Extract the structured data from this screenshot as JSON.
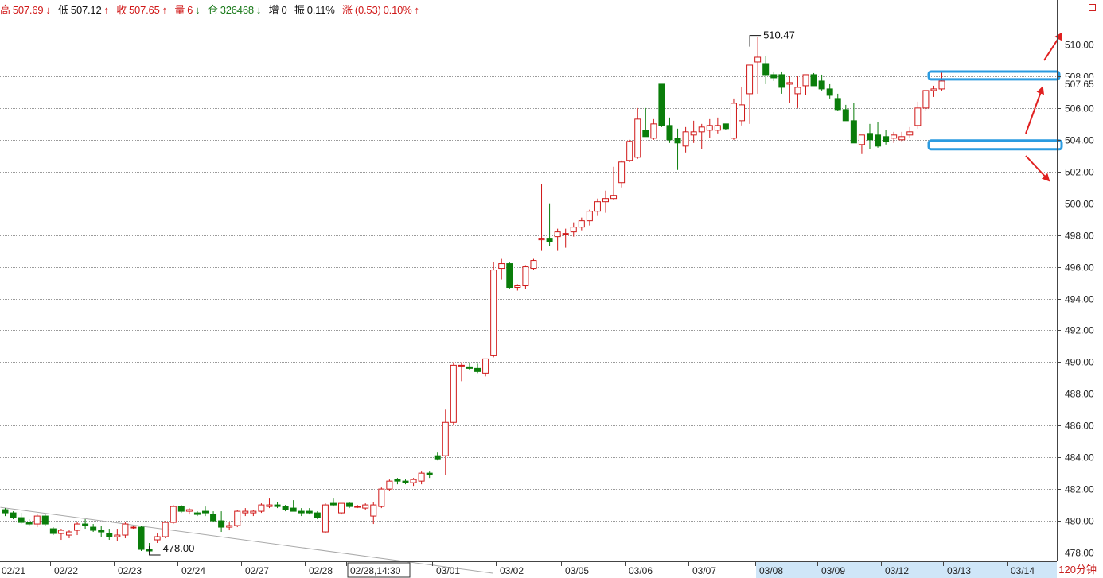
{
  "header": {
    "high_label": "高",
    "high_value": "507.69",
    "high_arrow": "↓",
    "low_label": "低",
    "low_value": "507.12",
    "low_arrow": "↑",
    "close_label": "收",
    "close_value": "507.65",
    "close_arrow": "↑",
    "volume_label": "量",
    "volume_value": "6",
    "volume_arrow": "↓",
    "oi_label": "仓",
    "oi_value": "326468",
    "oi_arrow": "↓",
    "increase_label": "增",
    "increase_value": "0",
    "amplitude_label": "振",
    "amplitude_value": "0.11%",
    "change_label": "涨",
    "change_value": "(0.53)",
    "change_pct": "0.10%",
    "change_arrow": "↑"
  },
  "timeframe": "120分钟",
  "colors": {
    "up": "#d01818",
    "down": "#0a7d0a",
    "highlight": "#2b9be0",
    "arrow": "#e02020",
    "grid": "#9a9a9a"
  },
  "chart_data": {
    "type": "candlestick",
    "ylim": [
      477.6,
      511.6
    ],
    "y_ticks": [
      "478.00",
      "480.00",
      "482.00",
      "484.00",
      "486.00",
      "488.00",
      "490.00",
      "492.00",
      "494.00",
      "496.00",
      "498.00",
      "500.00",
      "502.00",
      "504.00",
      "506.00",
      "508.00",
      "510.00"
    ],
    "x_labels": [
      "02/21",
      "02/22",
      "02/23",
      "02/24",
      "02/27",
      "02/28",
      "02/28,14:30",
      "03/01",
      "03/02",
      "03/05",
      "03/06",
      "03/07",
      "03/08",
      "03/09",
      "03/12",
      "03/13",
      "03/14"
    ],
    "current_price": "507.65",
    "annotations": {
      "max": "510.47",
      "min": "478.00"
    },
    "candles": [
      [
        480.7,
        480.8,
        480.3,
        480.5
      ],
      [
        480.5,
        480.6,
        480.1,
        480.2
      ],
      [
        480.2,
        480.5,
        479.8,
        479.9
      ],
      [
        479.9,
        480.1,
        479.7,
        479.8
      ],
      [
        479.8,
        480.4,
        479.6,
        480.3
      ],
      [
        480.3,
        480.4,
        479.7,
        479.8
      ],
      [
        479.5,
        479.6,
        479.1,
        479.2
      ],
      [
        479.2,
        479.5,
        478.8,
        479.4
      ],
      [
        479.1,
        479.4,
        478.9,
        479.3
      ],
      [
        479.4,
        479.9,
        479.1,
        479.8
      ],
      [
        479.8,
        480.1,
        479.5,
        479.7
      ],
      [
        479.6,
        479.8,
        479.3,
        479.4
      ],
      [
        479.4,
        479.7,
        479.0,
        479.3
      ],
      [
        479.2,
        479.5,
        478.8,
        479.0
      ],
      [
        479.0,
        479.5,
        478.7,
        479.1
      ],
      [
        479.1,
        479.9,
        478.9,
        479.8
      ],
      [
        479.6,
        479.7,
        479.5,
        479.6
      ],
      [
        479.6,
        479.7,
        478.1,
        478.2
      ],
      [
        478.2,
        478.6,
        478.0,
        478.1
      ],
      [
        478.8,
        479.2,
        478.6,
        479.0
      ],
      [
        479.0,
        480.0,
        478.9,
        479.9
      ],
      [
        479.9,
        481.0,
        479.8,
        480.9
      ],
      [
        480.9,
        481.0,
        480.5,
        480.6
      ],
      [
        480.6,
        480.8,
        480.4,
        480.7
      ],
      [
        480.5,
        480.6,
        480.3,
        480.4
      ],
      [
        480.6,
        480.9,
        480.3,
        480.5
      ],
      [
        480.4,
        480.6,
        479.9,
        480.0
      ],
      [
        480.0,
        480.6,
        479.3,
        479.6
      ],
      [
        479.6,
        479.9,
        479.4,
        479.7
      ],
      [
        479.7,
        480.7,
        479.6,
        480.6
      ],
      [
        480.5,
        480.8,
        480.3,
        480.6
      ],
      [
        480.5,
        480.7,
        480.3,
        480.6
      ],
      [
        480.6,
        481.1,
        480.5,
        481.0
      ],
      [
        480.9,
        481.4,
        480.8,
        481.0
      ],
      [
        481.0,
        481.2,
        480.8,
        480.9
      ],
      [
        480.9,
        481.0,
        480.6,
        480.7
      ],
      [
        480.8,
        481.3,
        480.6,
        480.6
      ],
      [
        480.6,
        480.8,
        480.3,
        480.5
      ],
      [
        480.6,
        480.8,
        480.4,
        480.5
      ],
      [
        480.5,
        480.6,
        480.1,
        480.2
      ],
      [
        479.3,
        481.1,
        479.2,
        481.0
      ],
      [
        481.1,
        481.4,
        480.9,
        481.0
      ],
      [
        480.5,
        481.1,
        480.4,
        481.1
      ],
      [
        481.1,
        481.2,
        480.8,
        480.9
      ],
      [
        480.9,
        481.0,
        480.8,
        480.9
      ],
      [
        480.8,
        481.1,
        480.7,
        481.0
      ],
      [
        480.3,
        481.2,
        479.8,
        481.0
      ],
      [
        480.9,
        482.1,
        480.8,
        482.0
      ],
      [
        482.0,
        482.6,
        481.9,
        482.5
      ],
      [
        482.6,
        482.7,
        482.3,
        482.5
      ],
      [
        482.5,
        482.6,
        482.3,
        482.4
      ],
      [
        482.4,
        482.7,
        482.2,
        482.6
      ],
      [
        482.5,
        483.1,
        482.3,
        483.0
      ],
      [
        483.0,
        483.1,
        482.7,
        482.9
      ],
      [
        484.1,
        484.3,
        483.8,
        483.9
      ],
      [
        484.1,
        487.0,
        482.9,
        486.2
      ],
      [
        486.2,
        490.0,
        486.0,
        489.8
      ],
      [
        489.8,
        490.0,
        488.8,
        489.8
      ],
      [
        489.7,
        490.0,
        489.5,
        489.6
      ],
      [
        489.6,
        489.9,
        489.3,
        489.4
      ],
      [
        489.3,
        490.2,
        489.1,
        490.2
      ],
      [
        490.4,
        496.3,
        490.3,
        495.8
      ],
      [
        495.9,
        496.5,
        495.2,
        496.2
      ],
      [
        496.2,
        496.3,
        494.6,
        494.7
      ],
      [
        494.7,
        494.9,
        494.5,
        494.8
      ],
      [
        494.8,
        496.1,
        494.6,
        496.0
      ],
      [
        495.9,
        496.5,
        495.8,
        496.4
      ],
      [
        497.7,
        501.2,
        497.0,
        497.8
      ],
      [
        497.8,
        500.0,
        497.3,
        497.6
      ],
      [
        497.9,
        498.4,
        497.0,
        498.2
      ],
      [
        498.1,
        498.4,
        497.2,
        498.1
      ],
      [
        498.2,
        498.8,
        497.9,
        498.5
      ],
      [
        498.5,
        499.1,
        498.3,
        498.9
      ],
      [
        498.9,
        499.6,
        498.6,
        499.5
      ],
      [
        499.5,
        500.3,
        499.2,
        500.1
      ],
      [
        500.1,
        500.8,
        499.4,
        500.3
      ],
      [
        500.3,
        502.3,
        500.2,
        500.5
      ],
      [
        501.3,
        502.7,
        501.0,
        502.6
      ],
      [
        502.7,
        504.0,
        502.6,
        503.9
      ],
      [
        502.9,
        506.0,
        502.8,
        505.3
      ],
      [
        504.6,
        506.0,
        504.3,
        504.2
      ],
      [
        504.1,
        505.3,
        504.0,
        505.0
      ],
      [
        507.5,
        507.5,
        504.8,
        504.9
      ],
      [
        504.9,
        505.4,
        503.8,
        504.0
      ],
      [
        504.1,
        504.7,
        502.1,
        503.8
      ],
      [
        503.6,
        504.8,
        503.2,
        504.5
      ],
      [
        504.3,
        505.2,
        503.8,
        504.5
      ],
      [
        504.5,
        505.0,
        503.4,
        504.8
      ],
      [
        504.6,
        505.3,
        504.1,
        504.9
      ],
      [
        504.6,
        505.4,
        504.4,
        504.9
      ],
      [
        505.0,
        505.0,
        504.6,
        504.7
      ],
      [
        504.1,
        506.6,
        504.0,
        506.3
      ],
      [
        505.2,
        507.3,
        504.9,
        506.2
      ],
      [
        506.9,
        508.2,
        505.0,
        508.7
      ],
      [
        508.9,
        510.5,
        506.9,
        509.2
      ],
      [
        508.8,
        509.3,
        507.5,
        508.1
      ],
      [
        508.1,
        508.3,
        507.7,
        507.9
      ],
      [
        508.1,
        508.3,
        506.9,
        507.3
      ],
      [
        507.5,
        508.0,
        506.3,
        507.6
      ],
      [
        506.9,
        508.0,
        506.0,
        507.3
      ],
      [
        507.4,
        508.0,
        506.8,
        508.1
      ],
      [
        508.1,
        508.2,
        507.4,
        507.4
      ],
      [
        507.7,
        508.1,
        507.1,
        507.2
      ],
      [
        507.2,
        507.5,
        506.6,
        506.8
      ],
      [
        506.6,
        506.9,
        505.8,
        505.9
      ],
      [
        505.9,
        506.2,
        505.4,
        505.2
      ],
      [
        505.2,
        506.3,
        504.0,
        503.8
      ],
      [
        503.7,
        504.1,
        503.1,
        504.3
      ],
      [
        504.4,
        505.0,
        503.4,
        504.0
      ],
      [
        504.3,
        505.1,
        503.5,
        503.6
      ],
      [
        504.2,
        504.6,
        503.7,
        503.9
      ],
      [
        504.1,
        504.5,
        503.8,
        504.3
      ],
      [
        504.0,
        504.5,
        503.9,
        504.2
      ],
      [
        504.3,
        504.8,
        504.1,
        504.5
      ],
      [
        504.9,
        506.4,
        504.7,
        506.0
      ],
      [
        506.0,
        507.0,
        505.8,
        507.1
      ],
      [
        507.1,
        507.4,
        506.7,
        507.2
      ],
      [
        507.2,
        508.3,
        507.1,
        507.7
      ]
    ],
    "highlight_boxes": [
      {
        "y_top": 508.25,
        "y_bottom": 507.95
      },
      {
        "y_top": 503.9,
        "y_bottom": 503.55
      }
    ],
    "trendline": {
      "from": [
        0,
        480.85
      ],
      "to": [
        45,
        476.9
      ]
    }
  }
}
